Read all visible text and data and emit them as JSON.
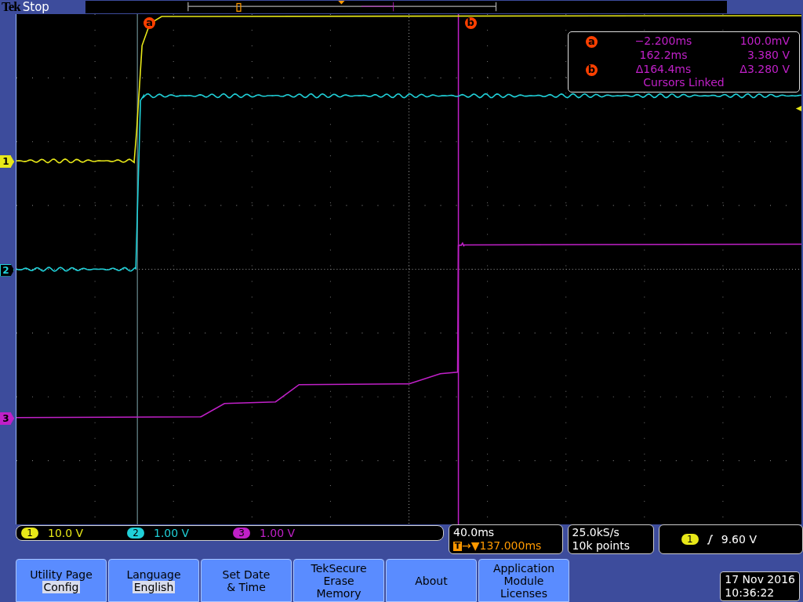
{
  "status_bar": {
    "brand": "Tek",
    "state": "Stop"
  },
  "channels": [
    {
      "marker": "1",
      "number": "1",
      "color": "#e8e818",
      "scale": "10.0 V"
    },
    {
      "marker": "2",
      "number": "2",
      "color": "#20d0d8",
      "scale": "1.00 V"
    },
    {
      "marker": "3",
      "number": "3",
      "color": "#c020c8",
      "scale": "1.00 V"
    }
  ],
  "cursor_markers": [
    "a",
    "b"
  ],
  "cursor_readout": {
    "rows": [
      {
        "marker": "a",
        "time": "−2.200ms",
        "value": "100.0mV"
      },
      {
        "time": "162.2ms",
        "value": "3.380 V"
      },
      {
        "marker": "b",
        "time": "Δ164.4ms",
        "value": "Δ3.280 V"
      }
    ],
    "note": "Cursors Linked"
  },
  "timebase": {
    "scale": "40.0ms",
    "trigger_mark": "T",
    "position": "→▼137.000ms"
  },
  "acquisition": {
    "sample_rate": "25.0kS/s",
    "record_length": "10k points"
  },
  "trigger": {
    "source": "1",
    "level": "9.60 V"
  },
  "menu": [
    {
      "label": [
        "Utility Page"
      ],
      "value": "Config"
    },
    {
      "label": [
        "Language"
      ],
      "value": "English"
    },
    {
      "label": [
        "Set Date",
        "& Time"
      ]
    },
    {
      "label": [
        "TekSecure",
        "Erase",
        "Memory"
      ]
    },
    {
      "label": [
        "About"
      ]
    },
    {
      "label": [
        "Application",
        "Module",
        "Licenses"
      ]
    }
  ],
  "datetime": {
    "date": "17 Nov 2016",
    "time": "10:36:22"
  }
}
